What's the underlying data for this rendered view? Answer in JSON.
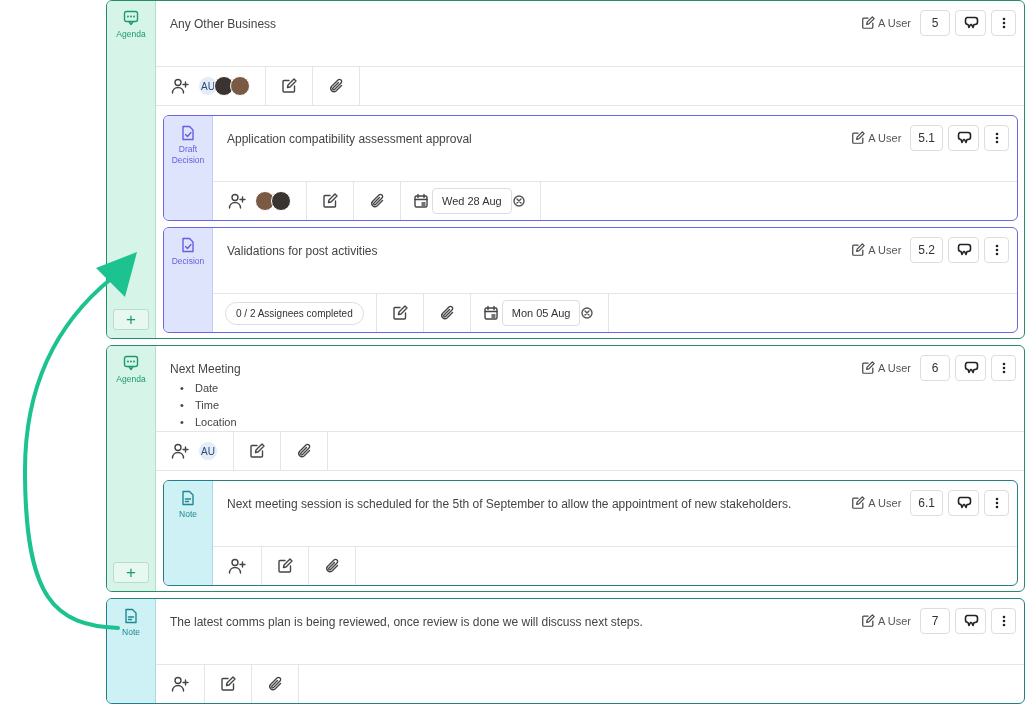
{
  "items": [
    {
      "kind": "agenda",
      "type_label": "Agenda",
      "title": "Any Other Business",
      "author": "A User",
      "number": "5",
      "add_label": "+",
      "assignees": [
        {
          "kind": "initials",
          "text": "AU"
        },
        {
          "kind": "photo"
        },
        {
          "kind": "photo"
        }
      ],
      "children": [
        {
          "kind": "decision",
          "type_label": "Draft Decision",
          "title": "Application compatibility assessment approval",
          "author": "A User",
          "number": "5.1",
          "assignees": [
            {
              "kind": "photo"
            },
            {
              "kind": "photo"
            }
          ],
          "date": "Wed 28 Aug"
        },
        {
          "kind": "decision",
          "type_label": "Decision",
          "title": "Validations for post activities",
          "author": "A User",
          "number": "5.2",
          "progress": "0 / 2 Assignees completed",
          "date": "Mon 05 Aug"
        }
      ]
    },
    {
      "kind": "agenda",
      "type_label": "Agenda",
      "title": "Next Meeting",
      "bullets": [
        {
          "marker": "•",
          "text": "Date"
        },
        {
          "marker": "•",
          "text": "Time"
        },
        {
          "marker": "•",
          "text": "Location"
        }
      ],
      "author": "A User",
      "number": "6",
      "add_label": "+",
      "assignees": [
        {
          "kind": "initials",
          "text": "AU"
        }
      ],
      "children": [
        {
          "kind": "note",
          "type_label": "Note",
          "title": "Next meeting session is scheduled for the 5th of September to allow the appointment of new stakeholders.",
          "author": "A User",
          "number": "6.1"
        }
      ]
    },
    {
      "kind": "note",
      "type_label": "Note",
      "title": "The latest comms plan is being reviewed, once review is done we will discuss next steps.",
      "author": "A User",
      "number": "7"
    }
  ]
}
